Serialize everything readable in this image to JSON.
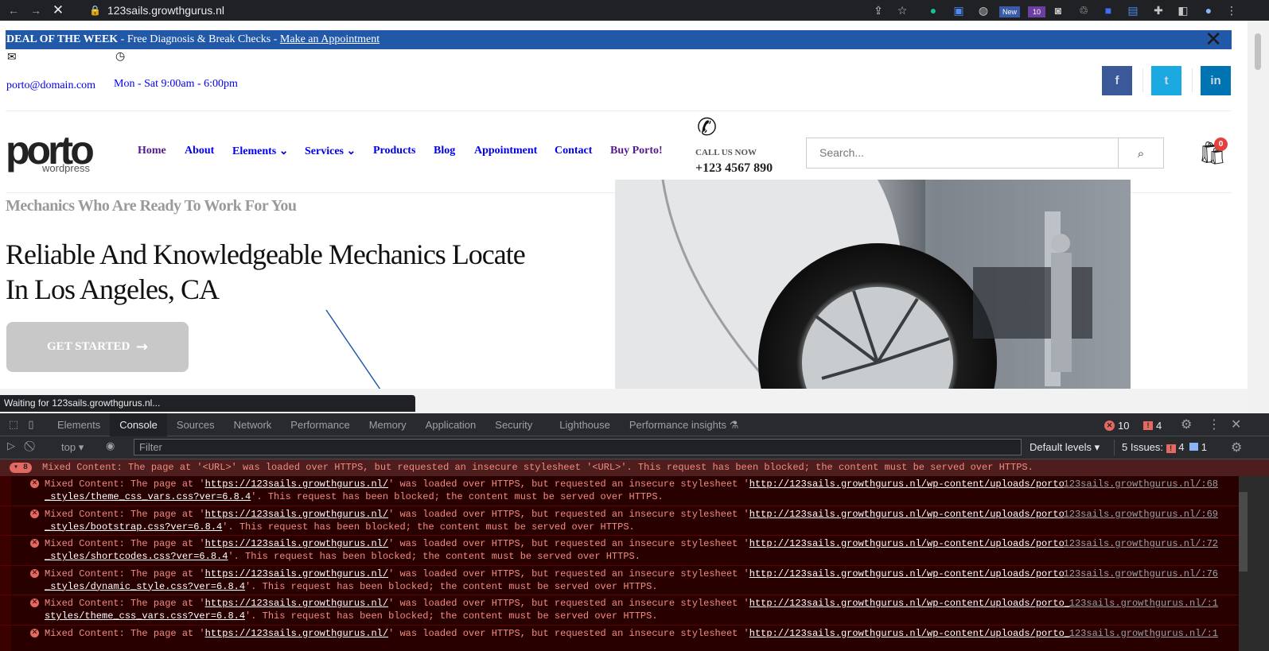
{
  "browser": {
    "url": "123sails.growthgurus.nl",
    "status": "Waiting for 123sails.growthgurus.nl...",
    "ext_badges": [
      "New",
      "10"
    ]
  },
  "topbar": {
    "deal_bold": "DEAL OF THE WEEK",
    "deal_text": " - Free Diagnosis & Break Checks - ",
    "deal_link": "Make an Appointment",
    "close": "✕"
  },
  "contact": {
    "email": "porto@domain.com",
    "hours": "Mon - Sat 9:00am - 6:00pm"
  },
  "social": {
    "facebook": "f",
    "twitter": "t",
    "linkedin": "in"
  },
  "logo": {
    "main": "porto",
    "sub": "wordpress"
  },
  "nav": {
    "home": "Home",
    "about": "About",
    "elements": "Elements",
    "services": "Services",
    "products": "Products",
    "blog": "Blog",
    "appointment": "Appointment",
    "contact": "Contact",
    "buy": "Buy Porto!",
    "caret": "⌄"
  },
  "call": {
    "label": "CALL US NOW",
    "number": "+123 4567 890"
  },
  "search": {
    "placeholder": "Search..."
  },
  "cart": {
    "count": "0"
  },
  "hero": {
    "kicker": "Mechanics Who Are Ready To Work For You",
    "line1": "Reliable And Knowledgeable Mechanics Locate",
    "line2": "In Los Angeles, CA",
    "cta": "GET STARTED"
  },
  "devtools": {
    "tabs": [
      "Elements",
      "Console",
      "Sources",
      "Network",
      "Performance",
      "Memory",
      "Application",
      "Security",
      "Lighthouse",
      "Performance insights"
    ],
    "errors": "10",
    "warnings": "4",
    "context": "top",
    "filter_placeholder": "Filter",
    "levels": "Default levels",
    "issues_label": "5 Issues:",
    "issues_err": "4",
    "issues_info": "1",
    "group_count": "8",
    "group_text": "Mixed Content: The page at '<URL>' was loaded over HTTPS, but requested an insecure stylesheet '<URL>'. This request has been blocked; the content must be served over HTTPS.",
    "messages": [
      {
        "pre": "Mixed Content: The page at '",
        "page": "https://123sails.growthgurus.nl/",
        "mid": "' was loaded over HTTPS, but requested an insecure stylesheet '",
        "res1": "http://123sails.growthgurus.nl/wp-content/uploads/porto",
        "res2": "_styles/theme_css_vars.css?ver=6.8.4",
        "post": "'. This request has been blocked; the content must be served over HTTPS.",
        "src": "123sails.growthgurus.nl/:68"
      },
      {
        "pre": "Mixed Content: The page at '",
        "page": "https://123sails.growthgurus.nl/",
        "mid": "' was loaded over HTTPS, but requested an insecure stylesheet '",
        "res1": "http://123sails.growthgurus.nl/wp-content/uploads/porto",
        "res2": "_styles/bootstrap.css?ver=6.8.4",
        "post": "'. This request has been blocked; the content must be served over HTTPS.",
        "src": "123sails.growthgurus.nl/:69"
      },
      {
        "pre": "Mixed Content: The page at '",
        "page": "https://123sails.growthgurus.nl/",
        "mid": "' was loaded over HTTPS, but requested an insecure stylesheet '",
        "res1": "http://123sails.growthgurus.nl/wp-content/uploads/porto",
        "res2": "_styles/shortcodes.css?ver=6.8.4",
        "post": "'. This request has been blocked; the content must be served over HTTPS.",
        "src": "123sails.growthgurus.nl/:72"
      },
      {
        "pre": "Mixed Content: The page at '",
        "page": "https://123sails.growthgurus.nl/",
        "mid": "' was loaded over HTTPS, but requested an insecure stylesheet '",
        "res1": "http://123sails.growthgurus.nl/wp-content/uploads/porto",
        "res2": "_styles/dynamic_style.css?ver=6.8.4",
        "post": "'. This request has been blocked; the content must be served over HTTPS.",
        "src": "123sails.growthgurus.nl/:76"
      },
      {
        "pre": "Mixed Content: The page at '",
        "page": "https://123sails.growthgurus.nl/",
        "mid": "' was loaded over HTTPS, but requested an insecure stylesheet '",
        "res1": "http://123sails.growthgurus.nl/wp-content/uploads/porto_",
        "res2": "styles/theme_css_vars.css?ver=6.8.4",
        "post": "'. This request has been blocked; the content must be served over HTTPS.",
        "src": "123sails.growthgurus.nl/:1"
      },
      {
        "pre": "Mixed Content: The page at '",
        "page": "https://123sails.growthgurus.nl/",
        "mid": "' was loaded over HTTPS, but requested an insecure stylesheet '",
        "res1": "http://123sails.growthgurus.nl/wp-content/uploads/porto_",
        "res2": "",
        "post": "",
        "src": "123sails.growthgurus.nl/:1"
      }
    ]
  }
}
